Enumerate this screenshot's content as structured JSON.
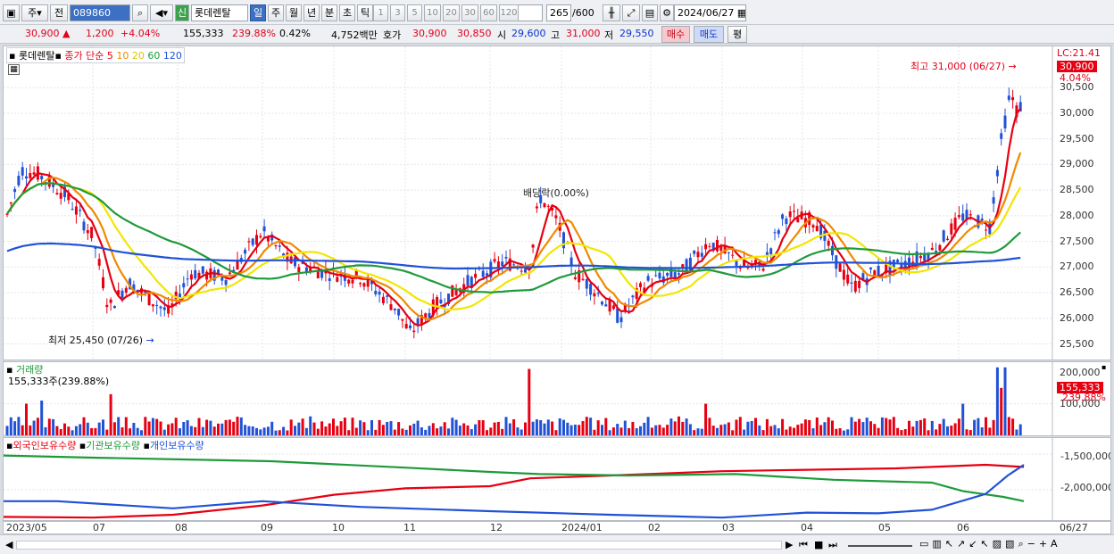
{
  "toolbar": {
    "market": "주",
    "market2": "전",
    "code": "089860",
    "badge": "신",
    "stock_name": "롯데렌탈",
    "tf": [
      "일",
      "주",
      "월",
      "년",
      "분",
      "초",
      "틱"
    ],
    "periods": [
      "1",
      "3",
      "5",
      "10",
      "20",
      "30",
      "60",
      "120"
    ],
    "count": "265",
    "count_total": "/600",
    "date": "2024/06/27"
  },
  "quote": {
    "price": "30,900",
    "change": "1,200",
    "change_pct": "+4.04%",
    "volume": "155,333",
    "volume_ratio": "239.88%",
    "turnover": "0.42%",
    "amount": "4,752백만",
    "hoga_label": "호가",
    "ask": "30,900",
    "bid": "30,850",
    "open_label": "시",
    "open": "29,600",
    "high_label": "고",
    "high": "31,000",
    "low_label": "저",
    "low": "29,550",
    "buy_label": "매수",
    "sell_label": "매도",
    "avg_label": "평"
  },
  "main_chart": {
    "legend_name": "롯데렌탈",
    "legend_text": "종가 단순",
    "ma_periods": [
      "5",
      "10",
      "20",
      "60",
      "120"
    ],
    "ma_colors": [
      "#e60012",
      "#f08a00",
      "#f2e600",
      "#1f9a3b",
      "#2152d6"
    ],
    "lc_label": "LC:21.41",
    "current_price": "30,900",
    "current_pct": "4.04%",
    "high_annotation": "최고 31,000 (06/27)",
    "low_annotation": "최저 25,450 (07/26)",
    "event_annotation": "배당락(0.00%)",
    "y_ticks": [
      "30,500",
      "30,000",
      "29,500",
      "29,000",
      "28,500",
      "28,000",
      "27,500",
      "27,000",
      "26,500",
      "26,000",
      "25,500"
    ]
  },
  "volume_chart": {
    "title": "거래량",
    "info": "155,333주(239.88%)",
    "y_ticks": [
      "200,000",
      "100,000"
    ],
    "current": "155,333",
    "current_pct": "239.88%"
  },
  "holdings_chart": {
    "series": [
      "외국인보유수량",
      "기관보유수량",
      "개인보유수량"
    ],
    "colors": [
      "#e60012",
      "#1f9a3b",
      "#2152d6"
    ],
    "y_ticks": [
      "-1,500,000",
      "-2,000,000"
    ]
  },
  "x_axis": [
    "2023/05",
    "07",
    "08",
    "09",
    "10",
    "11",
    "12",
    "2024/01",
    "02",
    "03",
    "04",
    "05",
    "06"
  ],
  "x_axis_end": "06/27",
  "chart_data": [
    {
      "type": "candlestick",
      "title": "롯데렌탈",
      "ylim": [
        25300,
        31200
      ],
      "series": [
        {
          "name": "5",
          "color": "#e60012"
        },
        {
          "name": "10",
          "color": "#f08a00"
        },
        {
          "name": "20",
          "color": "#f2e600"
        },
        {
          "name": "60",
          "color": "#1f9a3b"
        },
        {
          "name": "120",
          "color": "#2152d6"
        }
      ],
      "x": [
        "2023/05",
        "07",
        "08",
        "09",
        "10",
        "11",
        "12",
        "2024/01",
        "02",
        "03",
        "04",
        "05",
        "06",
        "06/27"
      ],
      "close": [
        28100,
        26400,
        26600,
        27600,
        26900,
        25600,
        27000,
        28100,
        26000,
        27100,
        28000,
        26800,
        27400,
        30900
      ],
      "ma120": [
        27050,
        27050,
        27000,
        26950,
        27080,
        27080,
        26900,
        26880,
        26880,
        26950,
        27000,
        27050,
        27100,
        27350
      ]
    },
    {
      "type": "bar",
      "title": "거래량",
      "ylim": [
        0,
        220000
      ],
      "last": 155333
    },
    {
      "type": "line",
      "title": "보유수량",
      "ylim": [
        -2400000,
        -1300000
      ]
    }
  ]
}
